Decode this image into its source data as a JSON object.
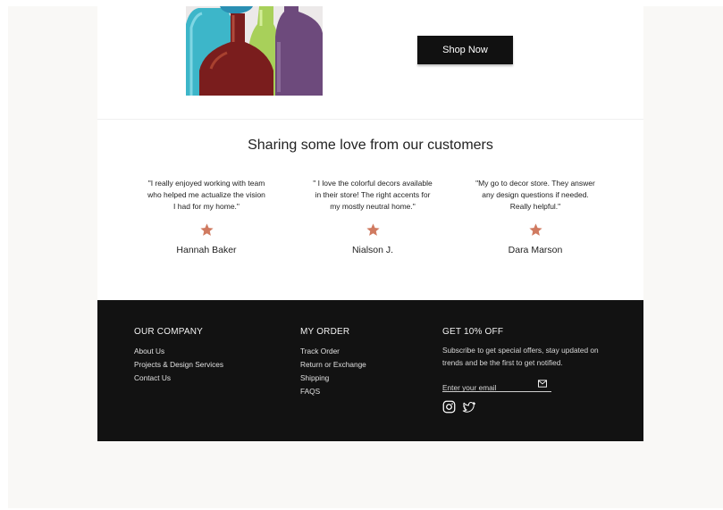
{
  "hero": {
    "shop_button_label": "Shop Now"
  },
  "testimonials": {
    "title": "Sharing some love from our customers",
    "star_color": "#d07a60",
    "items": [
      {
        "quote_lines": [
          "\"I really enjoyed working with team",
          "who helped me actualize the vision",
          "I had for my home.\""
        ],
        "author": "Hannah Baker"
      },
      {
        "quote_lines": [
          "\" I love the colorful decors available",
          "in their store!  The right accents for",
          "my mostly neutral home.\""
        ],
        "author": "Nialson J."
      },
      {
        "quote_lines": [
          "\"My go to decor store.  They answer",
          "any design questions if needed.",
          "Really helpful.\""
        ],
        "author": "Dara Marson"
      }
    ]
  },
  "footer": {
    "company": {
      "heading": "OUR COMPANY",
      "links": [
        "About Us",
        "Projects & Design Services",
        "Contact Us"
      ]
    },
    "order": {
      "heading": "MY ORDER",
      "links": [
        "Track Order",
        "Return or Exchange",
        "Shipping",
        "FAQS"
      ]
    },
    "newsletter": {
      "heading": "GET 10% OFF",
      "desc_lines": [
        "Subscribe to get special offers, stay updated on",
        "trends and be the first to get notified."
      ],
      "email_placeholder": "Enter your email"
    },
    "social_icons": [
      "instagram-icon",
      "twitter-icon"
    ]
  }
}
